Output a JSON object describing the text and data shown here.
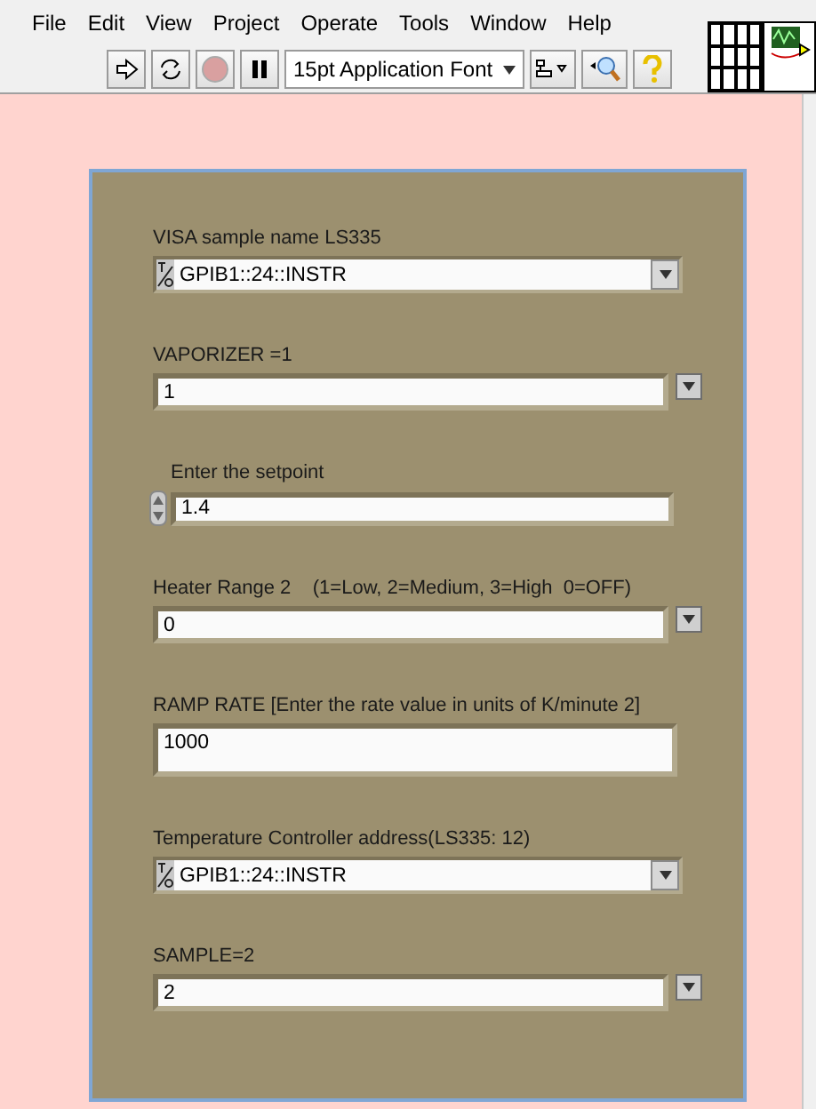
{
  "menu": [
    "File",
    "Edit",
    "View",
    "Project",
    "Operate",
    "Tools",
    "Window",
    "Help"
  ],
  "toolbar": {
    "font": "15pt Application Font"
  },
  "controls": [
    {
      "kind": "visa",
      "label": "VISA sample name LS335",
      "value": "GPIB1::24::INSTR"
    },
    {
      "kind": "ring",
      "label": "VAPORIZER =1",
      "value": "1"
    },
    {
      "kind": "numeric",
      "label": "Enter the setpoint",
      "value": "1.4"
    },
    {
      "kind": "ring",
      "label": "Heater Range 2    (1=Low, 2=Medium, 3=High  0=OFF)",
      "value": "0"
    },
    {
      "kind": "string",
      "label": "RAMP RATE [Enter the rate value in units of K/minute 2]",
      "value": "1000"
    },
    {
      "kind": "visa",
      "label": "Temperature Controller address(LS335: 12)",
      "value": "GPIB1::24::INSTR"
    },
    {
      "kind": "ring",
      "label": "SAMPLE=2",
      "value": "2"
    }
  ]
}
